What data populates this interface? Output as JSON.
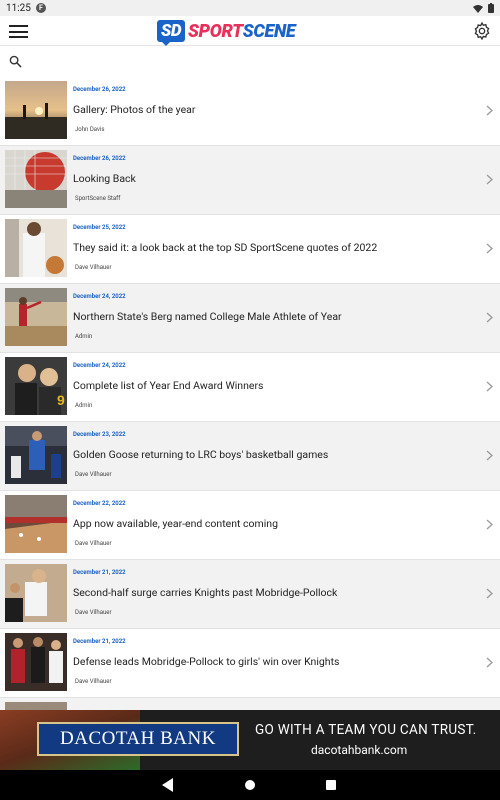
{
  "status_bar": {
    "time": "11:25",
    "notification_glyph": "F"
  },
  "header": {
    "logo_sd": "SD",
    "logo_sports": "SPORT",
    "logo_scene": "SCENE",
    "menu_icon": "hamburger-icon",
    "settings_icon": "gear-icon"
  },
  "search": {
    "icon": "search-icon"
  },
  "articles": [
    {
      "date": "December 26, 2022",
      "title": "Gallery: Photos of the year",
      "author": "John Davis"
    },
    {
      "date": "December 26, 2022",
      "title": "Looking Back",
      "author": "SportScene Staff"
    },
    {
      "date": "December 25, 2022",
      "title": "They said it: a look back at the top SD SportScene quotes of 2022",
      "author": "Dave Vilhauer"
    },
    {
      "date": "December 24, 2022",
      "title": "Northern State's Berg named College Male Athlete of Year",
      "author": "Admin"
    },
    {
      "date": "December 24, 2022",
      "title": "Complete list of Year End Award Winners",
      "author": "Admin"
    },
    {
      "date": "December 23, 2022",
      "title": "Golden Goose returning to LRC boys' basketball games",
      "author": "Dave Vilhauer"
    },
    {
      "date": "December 22, 2022",
      "title": "App now available, year-end content coming",
      "author": "Dave Vilhauer"
    },
    {
      "date": "December 21, 2022",
      "title": "Second-half surge carries Knights past Mobridge-Pollock",
      "author": "Dave Vilhauer"
    },
    {
      "date": "December 21, 2022",
      "title": "Defense leads Mobridge-Pollock to girls' win over Knights",
      "author": "Dave Vilhauer"
    }
  ],
  "ad": {
    "bank_name": "DACOTAH BANK",
    "tagline": "GO WITH A TEAM YOU CAN TRUST.",
    "url": "dacotahbank.com"
  },
  "colors": {
    "brand_blue": "#1a63c9",
    "brand_pink": "#e8305a",
    "date_blue": "#1a63c9"
  }
}
